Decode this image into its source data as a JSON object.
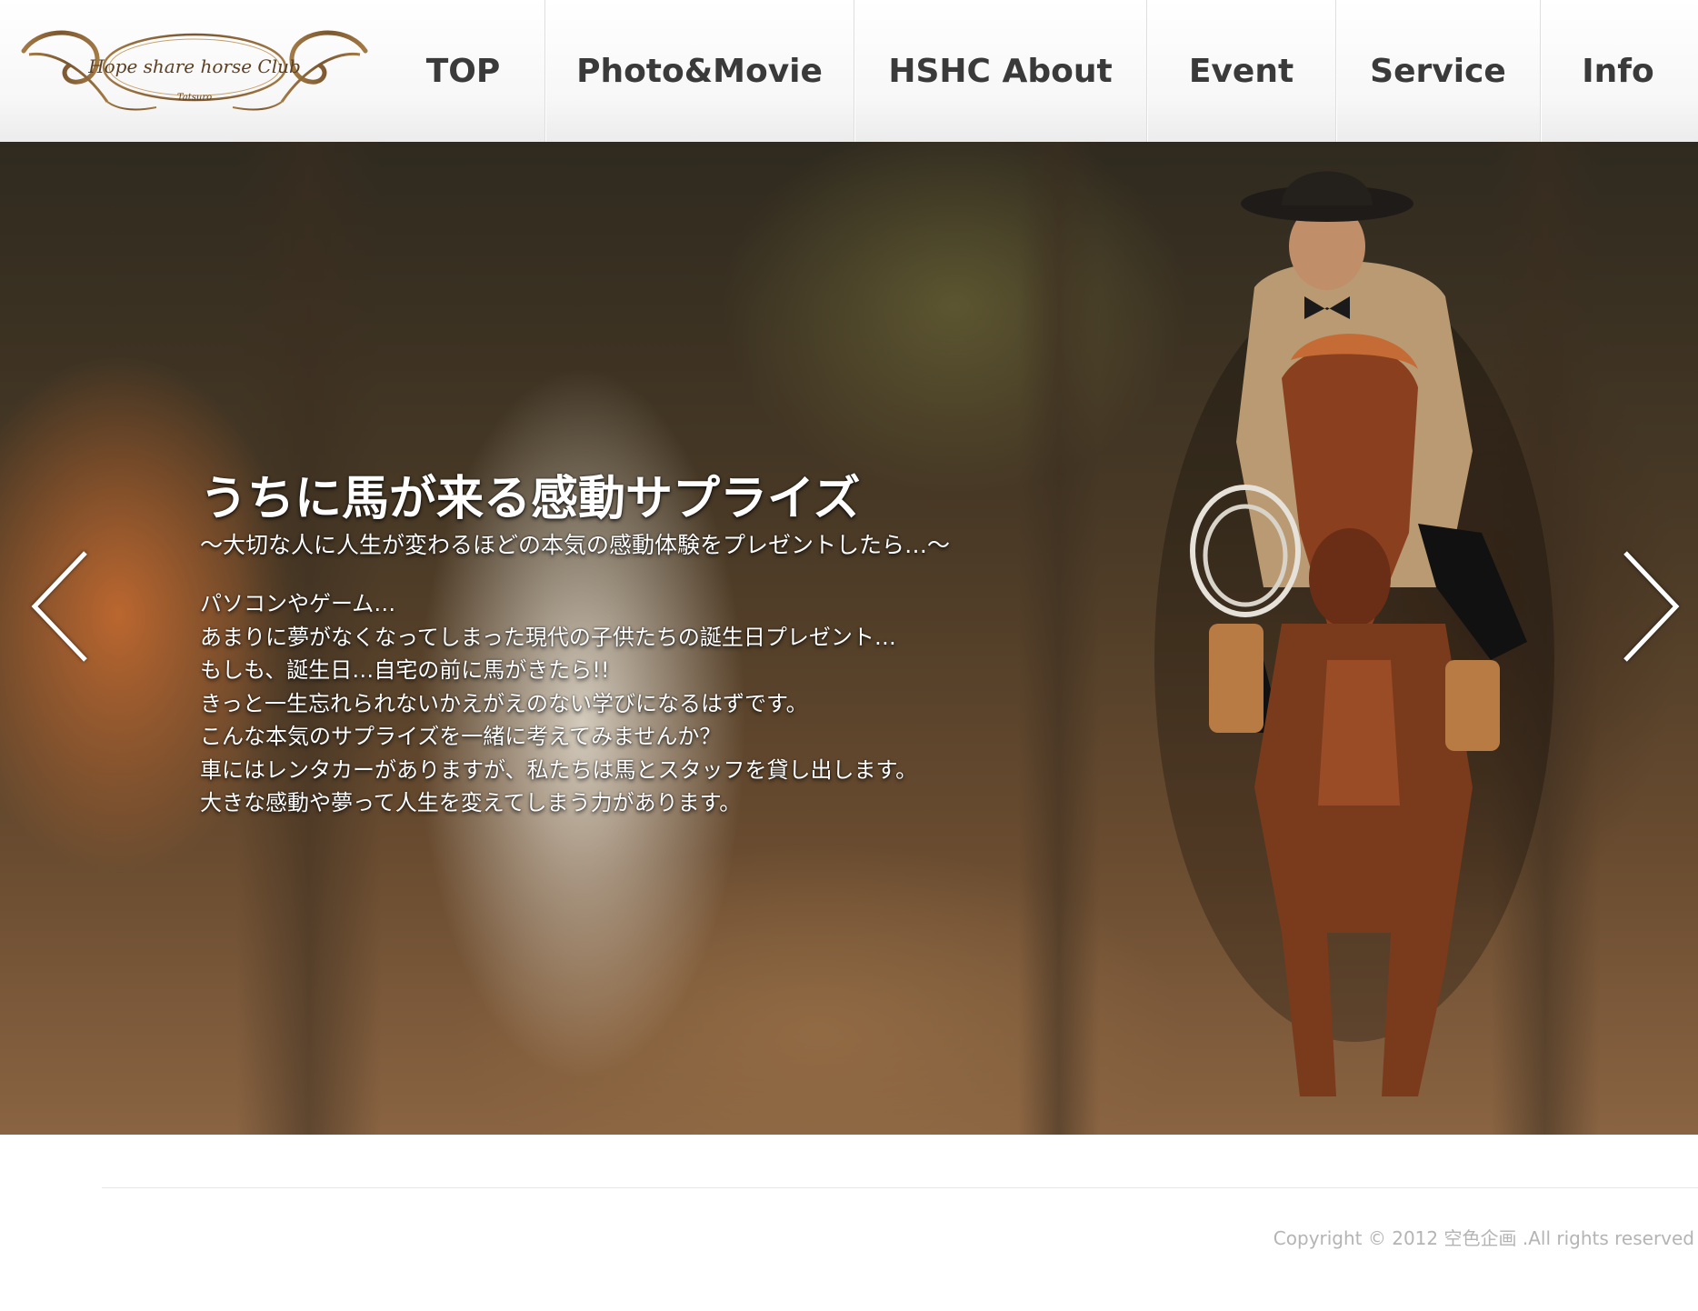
{
  "header": {
    "logo": {
      "icon": "hope-share-horse-club-logo",
      "text": "Hope share horse Club",
      "subtext": "Tatsuro"
    },
    "nav": [
      {
        "label": "TOP"
      },
      {
        "label": "Photo&Movie"
      },
      {
        "label": "HSHC About"
      },
      {
        "label": "Event"
      },
      {
        "label": "Service"
      },
      {
        "label": "Info"
      }
    ]
  },
  "hero": {
    "title": "うちに馬が来る感動サプライズ",
    "subtitle": "～大切な人に人生が変わるほどの本気の感動体験をプレゼントしたら…～",
    "body": [
      "パソコンやゲーム…",
      "あまりに夢がなくなってしまった現代の子供たちの誕生日プレゼント…",
      "もしも、誕生日…自宅の前に馬がきたら!!",
      "きっと一生忘れられないかえがえのない学びになるはずです。",
      "こんな本気のサプライズを一緒に考えてみませんか？",
      "車にはレンタカーがありますが、私たちは馬とスタッフを貸し出します。",
      "大きな感動や夢って人生を変えてしまう力があります。"
    ],
    "prev_icon": "chevron-left-icon",
    "next_icon": "chevron-right-icon",
    "image": "rider-on-horse-photo"
  },
  "footer": {
    "copyright": "Copyright © 2012 空色企画 .All rights reserved"
  },
  "colors": {
    "nav_text": "#3a3a3a",
    "logo_brown": "#8c6a3c",
    "copyright": "#b4b4b4"
  }
}
